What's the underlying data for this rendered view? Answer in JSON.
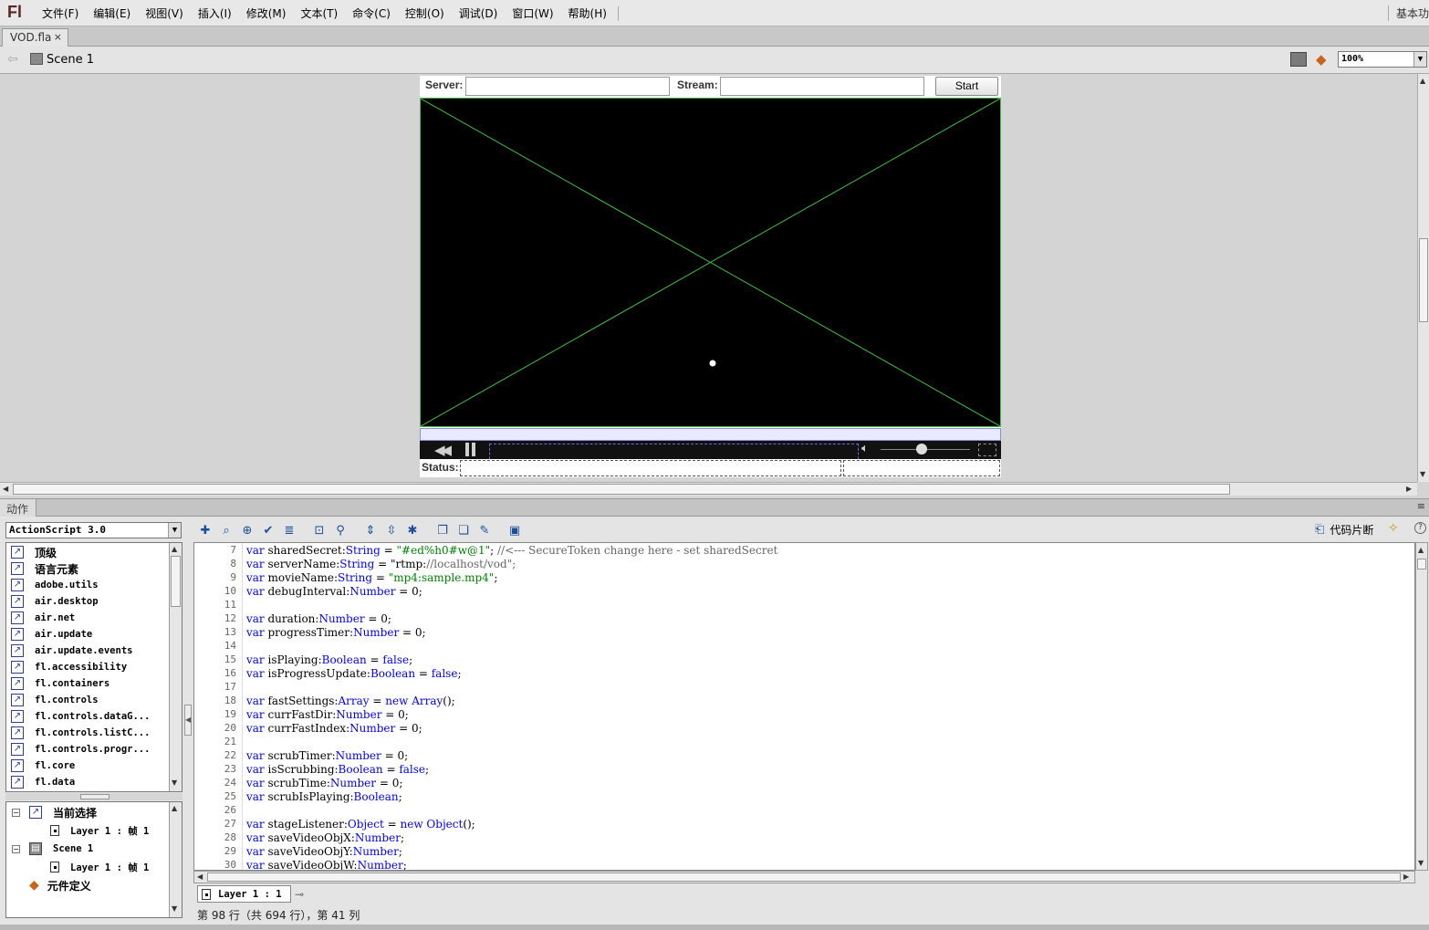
{
  "app": {
    "logo": "Fl",
    "workspace": "基本功"
  },
  "menu": [
    "文件(F)",
    "编辑(E)",
    "视图(V)",
    "插入(I)",
    "修改(M)",
    "文本(T)",
    "命令(C)",
    "控制(O)",
    "调试(D)",
    "窗口(W)",
    "帮助(H)"
  ],
  "document_tab": {
    "title": "VOD.fla",
    "close": "×"
  },
  "editbar": {
    "scene": "Scene 1",
    "zoom": "100%"
  },
  "stage": {
    "server_label": "Server:",
    "stream_label": "Stream:",
    "server_value": "",
    "stream_value": "",
    "start_label": "Start",
    "status_label": "Status:",
    "video_border_color": "#3fbf3f"
  },
  "panel": {
    "title": "动作",
    "menu_icon": "≡"
  },
  "actions": {
    "language": "ActionScript 3.0",
    "toolbox_items": [
      "顶级",
      "语言元素",
      "adobe.utils",
      "air.desktop",
      "air.net",
      "air.update",
      "air.update.events",
      "fl.accessibility",
      "fl.containers",
      "fl.controls",
      "fl.controls.dataG...",
      "fl.controls.listC...",
      "fl.controls.progr...",
      "fl.core",
      "fl.data"
    ],
    "tree": {
      "current_selection": "当前选择",
      "current_layer": "Layer 1 : 帧 1",
      "scene": "Scene 1",
      "scene_layer": "Layer 1 : 帧 1",
      "symbols": "元件定义"
    },
    "snippets_label": "代码片断",
    "help_icon": "?",
    "layer_tab": "Layer 1 : 1",
    "status": "第 98 行（共 694 行），第 41 列"
  },
  "code_lines": [
    {
      "n": "7",
      "t": "var sharedSecret:String = \"#ed%h0#w@1\"; //<--- SecureToken change here - set sharedSecret"
    },
    {
      "n": "8",
      "t": "var serverName:String = \"rtmp://localhost/vod\";"
    },
    {
      "n": "9",
      "t": "var movieName:String = \"mp4:sample.mp4\";"
    },
    {
      "n": "10",
      "t": "var debugInterval:Number = 0;"
    },
    {
      "n": "11",
      "t": ""
    },
    {
      "n": "12",
      "t": "var duration:Number = 0;"
    },
    {
      "n": "13",
      "t": "var progressTimer:Number = 0;"
    },
    {
      "n": "14",
      "t": ""
    },
    {
      "n": "15",
      "t": "var isPlaying:Boolean = false;"
    },
    {
      "n": "16",
      "t": "var isProgressUpdate:Boolean = false;"
    },
    {
      "n": "17",
      "t": ""
    },
    {
      "n": "18",
      "t": "var fastSettings:Array = new Array();"
    },
    {
      "n": "19",
      "t": "var currFastDir:Number = 0;"
    },
    {
      "n": "20",
      "t": "var currFastIndex:Number = 0;"
    },
    {
      "n": "21",
      "t": ""
    },
    {
      "n": "22",
      "t": "var scrubTimer:Number = 0;"
    },
    {
      "n": "23",
      "t": "var isScrubbing:Boolean = false;"
    },
    {
      "n": "24",
      "t": "var scrubTime:Number = 0;"
    },
    {
      "n": "25",
      "t": "var scrubIsPlaying:Boolean;"
    },
    {
      "n": "26",
      "t": ""
    },
    {
      "n": "27",
      "t": "var stageListener:Object = new Object();"
    },
    {
      "n": "28",
      "t": "var saveVideoObjX:Number;"
    },
    {
      "n": "29",
      "t": "var saveVideoObjY:Number;"
    },
    {
      "n": "30",
      "t": "var saveVideoObjW:Number;"
    }
  ]
}
